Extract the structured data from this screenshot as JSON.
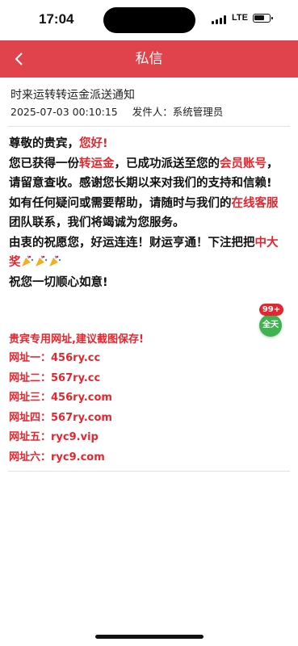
{
  "status_bar": {
    "time": "17:04",
    "network": "LTE"
  },
  "header": {
    "title": "私信",
    "back_icon": "chevron-left-icon"
  },
  "message": {
    "title": "时来运转转运金派送通知",
    "datetime": "2025-07-03 00:10:15",
    "sender_label": "发件人：",
    "sender": "系统管理员"
  },
  "body": {
    "greeting_1": "尊敬的贵宾，",
    "greeting_2": "您好!",
    "p1_a": " 您已获得一份",
    "p1_b": "转运金",
    "p1_c": "，已成功派送至您的",
    "p1_d": "会员账号",
    "p1_e": "，请留意查收。感谢您长期以来对我们的支持和信赖!",
    "p2_a": "如有任何疑问或需要帮助，请随时与我们的",
    "p2_b": "在线客服",
    "p2_c": "团队联系，我们将竭诚为您服务。",
    "p3_a": "由衷的祝愿您，好运连连！财运亨通！下注把把",
    "p3_b": "中大奖",
    "p4": "祝您一切顺心如意!",
    "emoji": "party-popper-icon"
  },
  "floating": {
    "badge": "99+",
    "label": "全天"
  },
  "links": {
    "heading": "贵宾专用网址,建议截图保存!",
    "items": [
      {
        "label": "网址一：",
        "url": "456ry.cc"
      },
      {
        "label": "网址二：",
        "url": "567ry.cc"
      },
      {
        "label": "网址三：",
        "url": "456ry.com"
      },
      {
        "label": "网址四：",
        "url": "567ry.com"
      },
      {
        "label": "网址五：",
        "url": "ryc9.vip"
      },
      {
        "label": "网址六：",
        "url": "ryc9.com"
      }
    ]
  },
  "colors": {
    "header": "#e0434c",
    "accent_red": "#e5262e",
    "badge_green": "#3fb34f"
  }
}
